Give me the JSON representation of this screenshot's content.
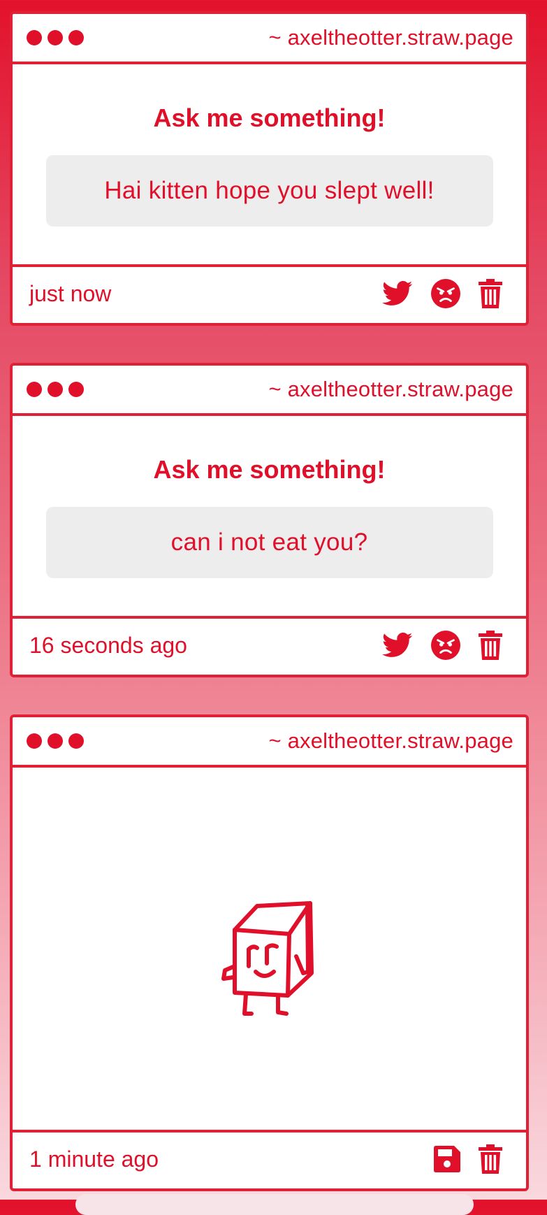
{
  "site_url": "~ axeltheotter.straw.page",
  "cards": [
    {
      "title": "Ask me something!",
      "message": "Hai kitten hope you slept well!",
      "time": "just now",
      "actions": [
        "twitter-icon",
        "angry-face-icon",
        "trash-icon"
      ]
    },
    {
      "title": "Ask me something!",
      "message": "can i not eat you?",
      "time": "16 seconds ago",
      "actions": [
        "twitter-icon",
        "angry-face-icon",
        "trash-icon"
      ]
    },
    {
      "drawing": "box-character-doodle",
      "time": "1 minute ago",
      "actions": [
        "save-icon",
        "trash-icon"
      ]
    }
  ],
  "colors": {
    "accent": "#e0102a",
    "box_bg": "#eeedee",
    "card_bg": "#ffffff"
  }
}
